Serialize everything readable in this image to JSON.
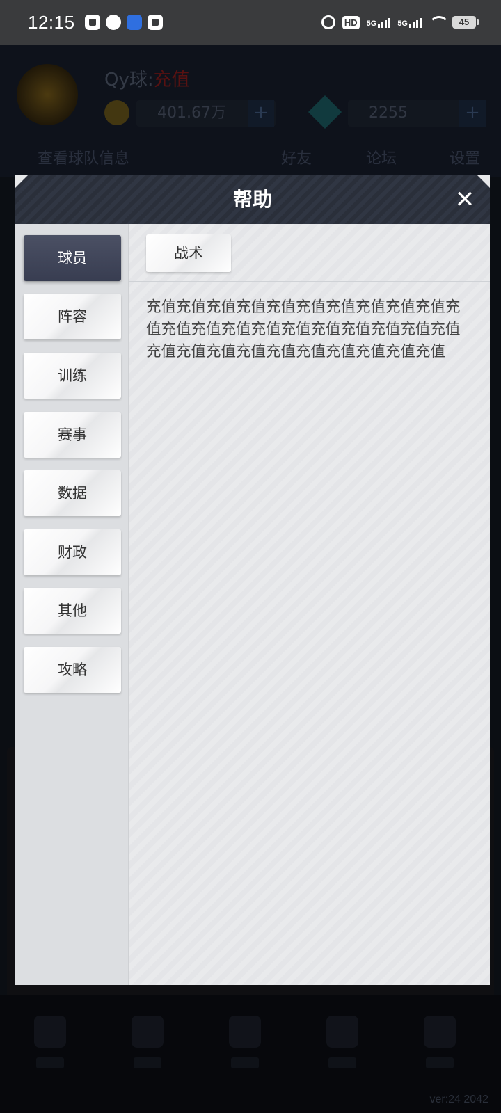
{
  "status_bar": {
    "time": "12:15",
    "hd_label": "HD",
    "network_1": "5G",
    "network_2": "5G",
    "battery": "45"
  },
  "background": {
    "player_label": "Qy球:",
    "player_status": "充值",
    "coins": "401.67万",
    "gems": "2255",
    "plus_label": "+",
    "team_label": "查看球队信息",
    "tab_1": "好友",
    "tab_2": "论坛",
    "tab_3": "设置",
    "version": "ver:24  2042"
  },
  "modal": {
    "title": "帮助",
    "close_label": "✕",
    "sidebar": [
      {
        "label": "球员",
        "active": true
      },
      {
        "label": "阵容",
        "active": false
      },
      {
        "label": "训练",
        "active": false
      },
      {
        "label": "赛事",
        "active": false
      },
      {
        "label": "数据",
        "active": false
      },
      {
        "label": "财政",
        "active": false
      },
      {
        "label": "其他",
        "active": false
      },
      {
        "label": "攻略",
        "active": false
      }
    ],
    "sub_tab": "战术",
    "content_text": "充值充值充值充值充值充值充值充值充值充值充值充值充值充值充值充值充值充值充值充值充值充值充值充值充值充值充值充值充值充值充值"
  }
}
